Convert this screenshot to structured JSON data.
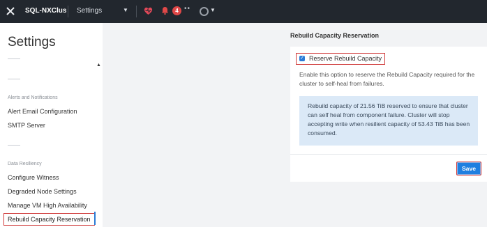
{
  "topbar": {
    "logo_icon": "nutanix-x-icon",
    "cluster_name": "SQL-NXClus",
    "menu_label": "Settings",
    "alert_count": "4",
    "dots": "••"
  },
  "sidebar": {
    "title": "Settings",
    "sections": [
      {
        "label": "Alerts and Notifications",
        "items": [
          "Alert Email Configuration",
          "SMTP Server"
        ]
      },
      {
        "label": "Data Resiliency",
        "items": [
          "Configure Witness",
          "Degraded Node Settings",
          "Manage VM High Availability",
          "Rebuild Capacity Reservation"
        ]
      }
    ],
    "active_item": "Rebuild Capacity Reservation"
  },
  "panel": {
    "title": "Rebuild Capacity Reservation",
    "checkbox_label": "Reserve Rebuild Capacity",
    "checkbox_checked": true,
    "description": "Enable this option to reserve the Rebuild Capacity required for the cluster to self-heal from failures.",
    "info": "Rebuild capacity of 21.56 TiB reserved to ensure that cluster can self heal from component failure. Cluster will stop accepting write when resilient capacity of 53.43 TiB has been consumed.",
    "save_label": "Save"
  },
  "colors": {
    "accent": "#1f7fe0",
    "highlight_border": "#d03a3a",
    "badge": "#e04848",
    "topbar_bg": "#22272e",
    "info_bg": "#dbe9f7"
  }
}
